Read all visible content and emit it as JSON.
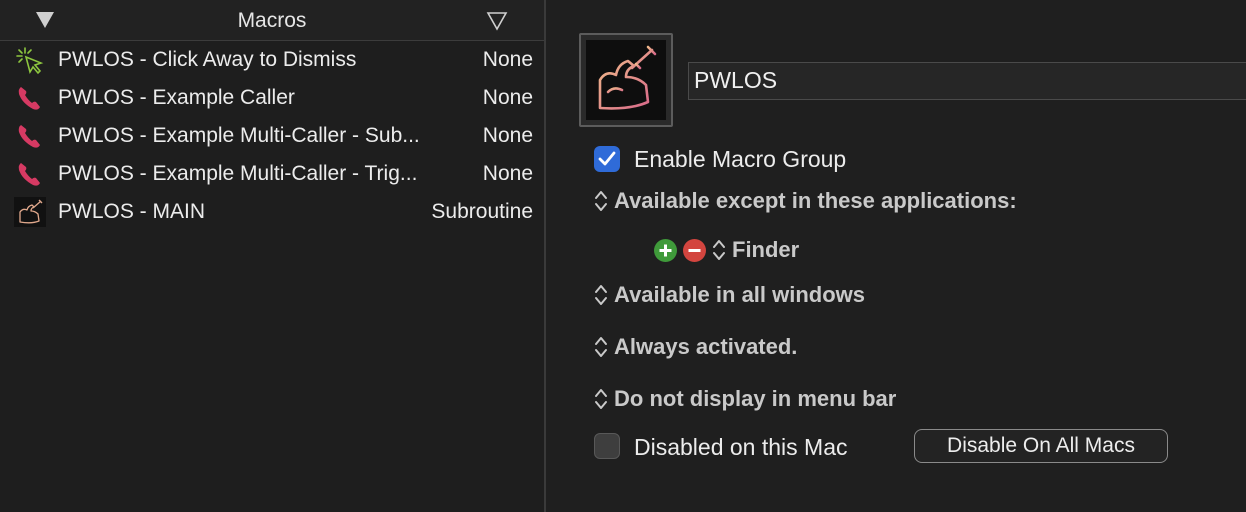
{
  "macro_list": {
    "header_title": "Macros",
    "rows": [
      {
        "icon": "pointer-click-icon",
        "name": "PWLOS - Click Away to Dismiss",
        "trigger": "None"
      },
      {
        "icon": "phone-icon",
        "name": "PWLOS - Example Caller",
        "trigger": "None"
      },
      {
        "icon": "phone-icon",
        "name": "PWLOS - Example Multi-Caller - Sub...",
        "trigger": "None"
      },
      {
        "icon": "phone-icon",
        "name": "PWLOS - Example Multi-Caller - Trig...",
        "trigger": "None"
      },
      {
        "icon": "flexed-arm-syringe-icon",
        "name": "PWLOS - MAIN",
        "trigger": "Subroutine"
      }
    ]
  },
  "group_editor": {
    "icon": "flexed-arm-syringe-icon",
    "name": "PWLOS",
    "enable_label": "Enable Macro Group",
    "enable_checked": true,
    "availability": "Available except in these applications:",
    "excluded_app": "Finder",
    "windows": "Available in all windows",
    "activation": "Always activated.",
    "menu_bar": "Do not display in menu bar",
    "disabled_label": "Disabled on this Mac",
    "disabled_checked": false,
    "disable_all_button": "Disable On All Macs"
  },
  "colors": {
    "checkbox_blue": "#2f6bd8",
    "add_green": "#3f9a3a",
    "remove_red": "#d3453f",
    "phone_pink": "#d63a63",
    "pointer_green": "#8dc63f"
  }
}
